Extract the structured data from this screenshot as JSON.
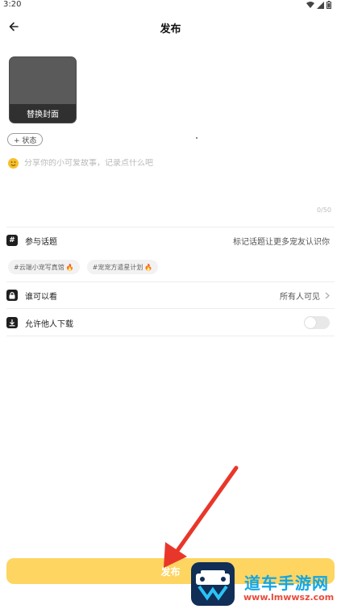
{
  "status_bar": {
    "time": "3:20"
  },
  "header": {
    "title": "发布"
  },
  "cover": {
    "label": "替换封面"
  },
  "status_chip": {
    "label": "+ 状态"
  },
  "compose": {
    "placeholder": "分享你的小可爱故事，记录点什么吧",
    "counter": "0/50"
  },
  "topic": {
    "label": "参与话题",
    "hint": "标记话题让更多宠友认识你",
    "tags": [
      {
        "text": "#云端小宠写真馆"
      },
      {
        "text": "#宠宠方遣星计划"
      }
    ]
  },
  "visibility": {
    "label": "谁可以看",
    "value": "所有人可见"
  },
  "download": {
    "label": "允许他人下载",
    "enabled": false
  },
  "publish_button": {
    "label": "发布"
  },
  "watermark": {
    "text": "道车手游网",
    "url": "www.lmwwsz.com"
  },
  "colors": {
    "accent": "#fdd560",
    "annotation_arrow": "#e8372a",
    "watermark_blue": "#10a6e6",
    "watermark_red": "#e84b3c"
  },
  "icons": {
    "back": "arrow-left-icon",
    "topic": "hash-icon",
    "visibility": "lock-icon",
    "download": "download-icon",
    "emoji": "smile-icon",
    "chevron": "chevron-right-icon",
    "flame": "flame-icon"
  }
}
